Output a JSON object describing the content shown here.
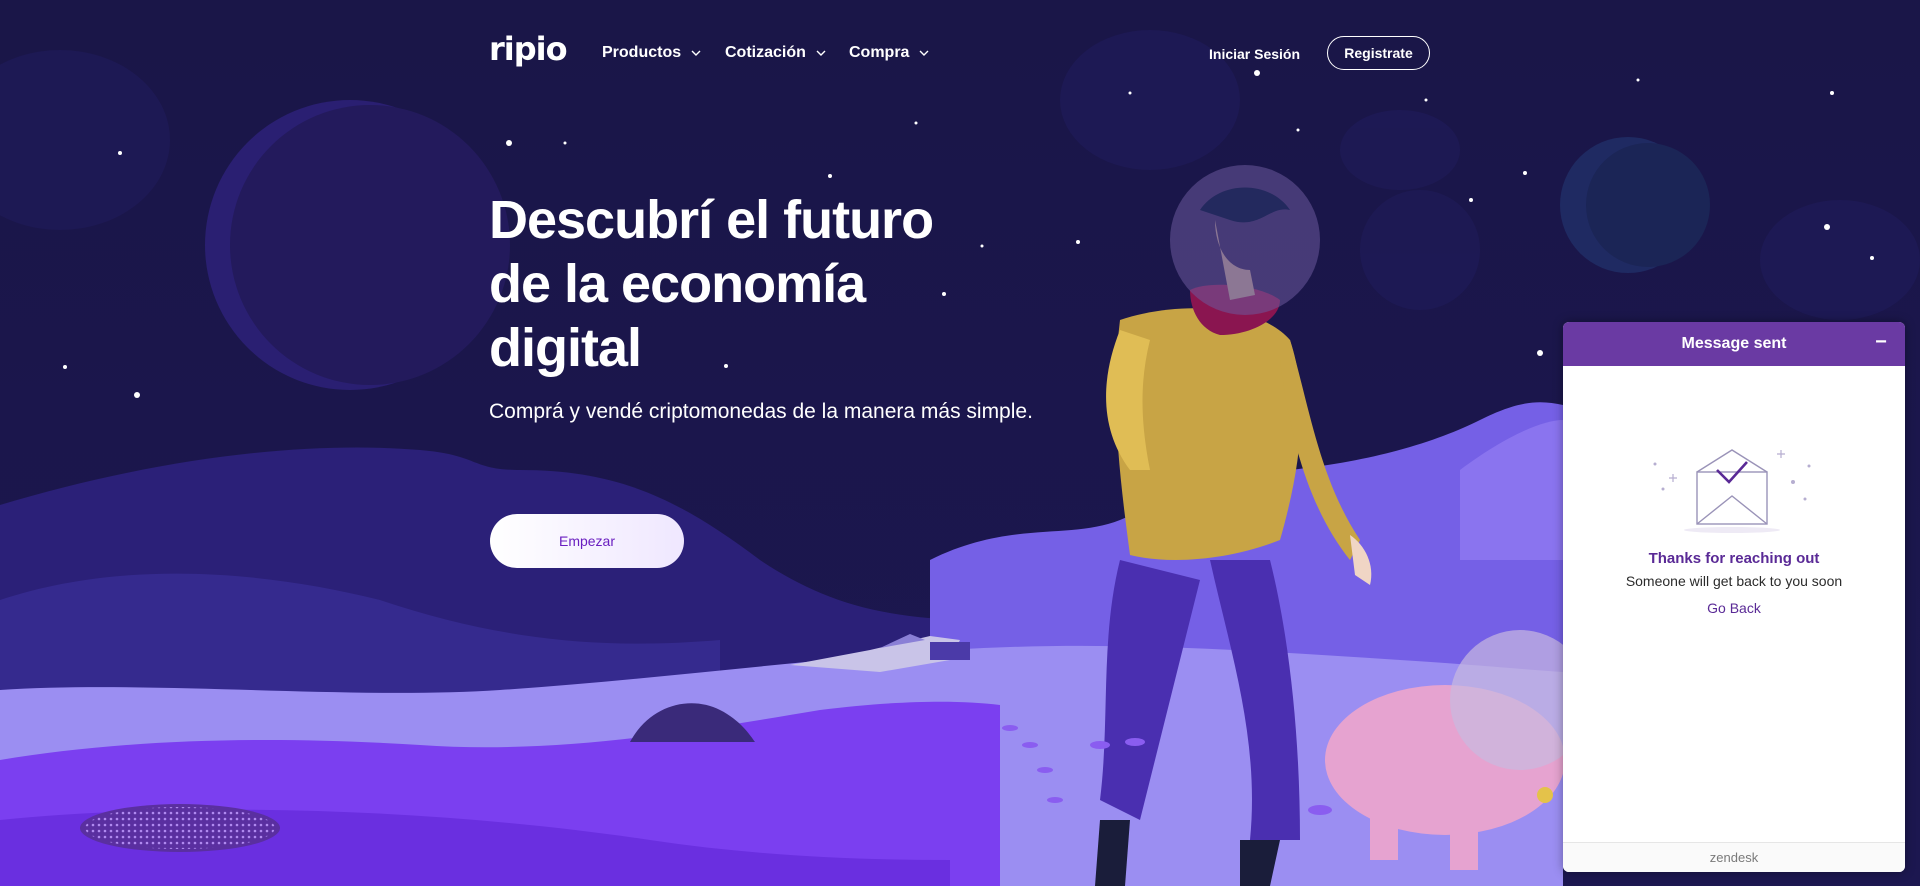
{
  "brand": {
    "logo_text": "ripio"
  },
  "nav": {
    "items": [
      {
        "label": "Productos"
      },
      {
        "label": "Cotización"
      },
      {
        "label": "Compra"
      }
    ],
    "login_label": "Iniciar Sesión",
    "register_label": "Registrate"
  },
  "hero": {
    "title_line1": "Descubrí el futuro",
    "title_line2": "de la economía",
    "title_line3": "digital",
    "subtitle": "Comprá y vendé criptomonedas de la manera más simple.",
    "cta_label": "Empezar"
  },
  "chat_widget": {
    "title": "Message sent",
    "minimize_icon": "minus-icon",
    "heading": "Thanks for reaching out",
    "message": "Someone will get back to you soon",
    "back_label": "Go Back",
    "footer": "zendesk"
  },
  "colors": {
    "sky": "#15123f",
    "hills_purple": "#6a4fe0",
    "ground_lilac": "#9c8ef0",
    "accent": "#6a3aa3",
    "cta_text": "#6a1fc0"
  }
}
